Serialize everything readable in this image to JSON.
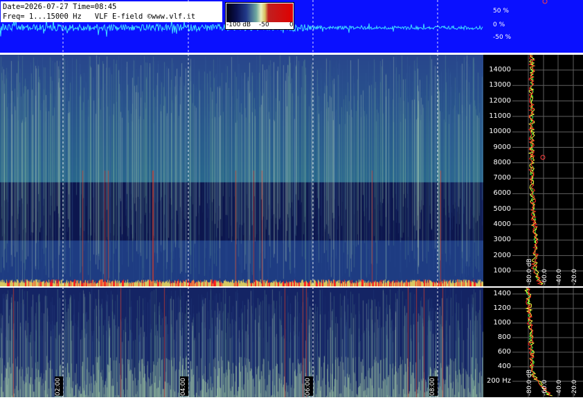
{
  "header": {
    "line1": "Date=2026-07-27 Time=08:45",
    "line2": "Freq= 1...15000 Hz   VLF E-field ©www.vlf.it"
  },
  "color_scale": {
    "labels": [
      "-100 dB",
      "-50",
      "0"
    ]
  },
  "amplitude_axis": {
    "labels": [
      "50 %",
      "0 %",
      "-50 %"
    ]
  },
  "freq_axis_high": {
    "labels": [
      "14000",
      "13000",
      "12000",
      "11000",
      "10000",
      "9000",
      "8000",
      "7000",
      "6000",
      "5000",
      "4000",
      "3000",
      "2000",
      "1000"
    ]
  },
  "freq_axis_low": {
    "labels": [
      "1400",
      "1200",
      "1000",
      "800",
      "600",
      "400",
      "200 Hz"
    ]
  },
  "profile_axis": {
    "labels": [
      "-80.0 dB",
      "-60.0",
      "-40.0",
      "-20.0"
    ]
  },
  "time_axis": {
    "labels": [
      "02:00",
      "04:00",
      "06:00",
      "08:00"
    ]
  },
  "colors": {
    "wave_bg": "#0a10ff",
    "wave_trace": "#40e0ff",
    "spec_dark": "#0c1448",
    "spec_mid": "#2c4c96",
    "spec_bright": "#7fb890",
    "spec_hot": "#d8c860",
    "profile_red": "#ff2020",
    "profile_yellow": "#ffff40",
    "profile_green": "#40ff40"
  }
}
